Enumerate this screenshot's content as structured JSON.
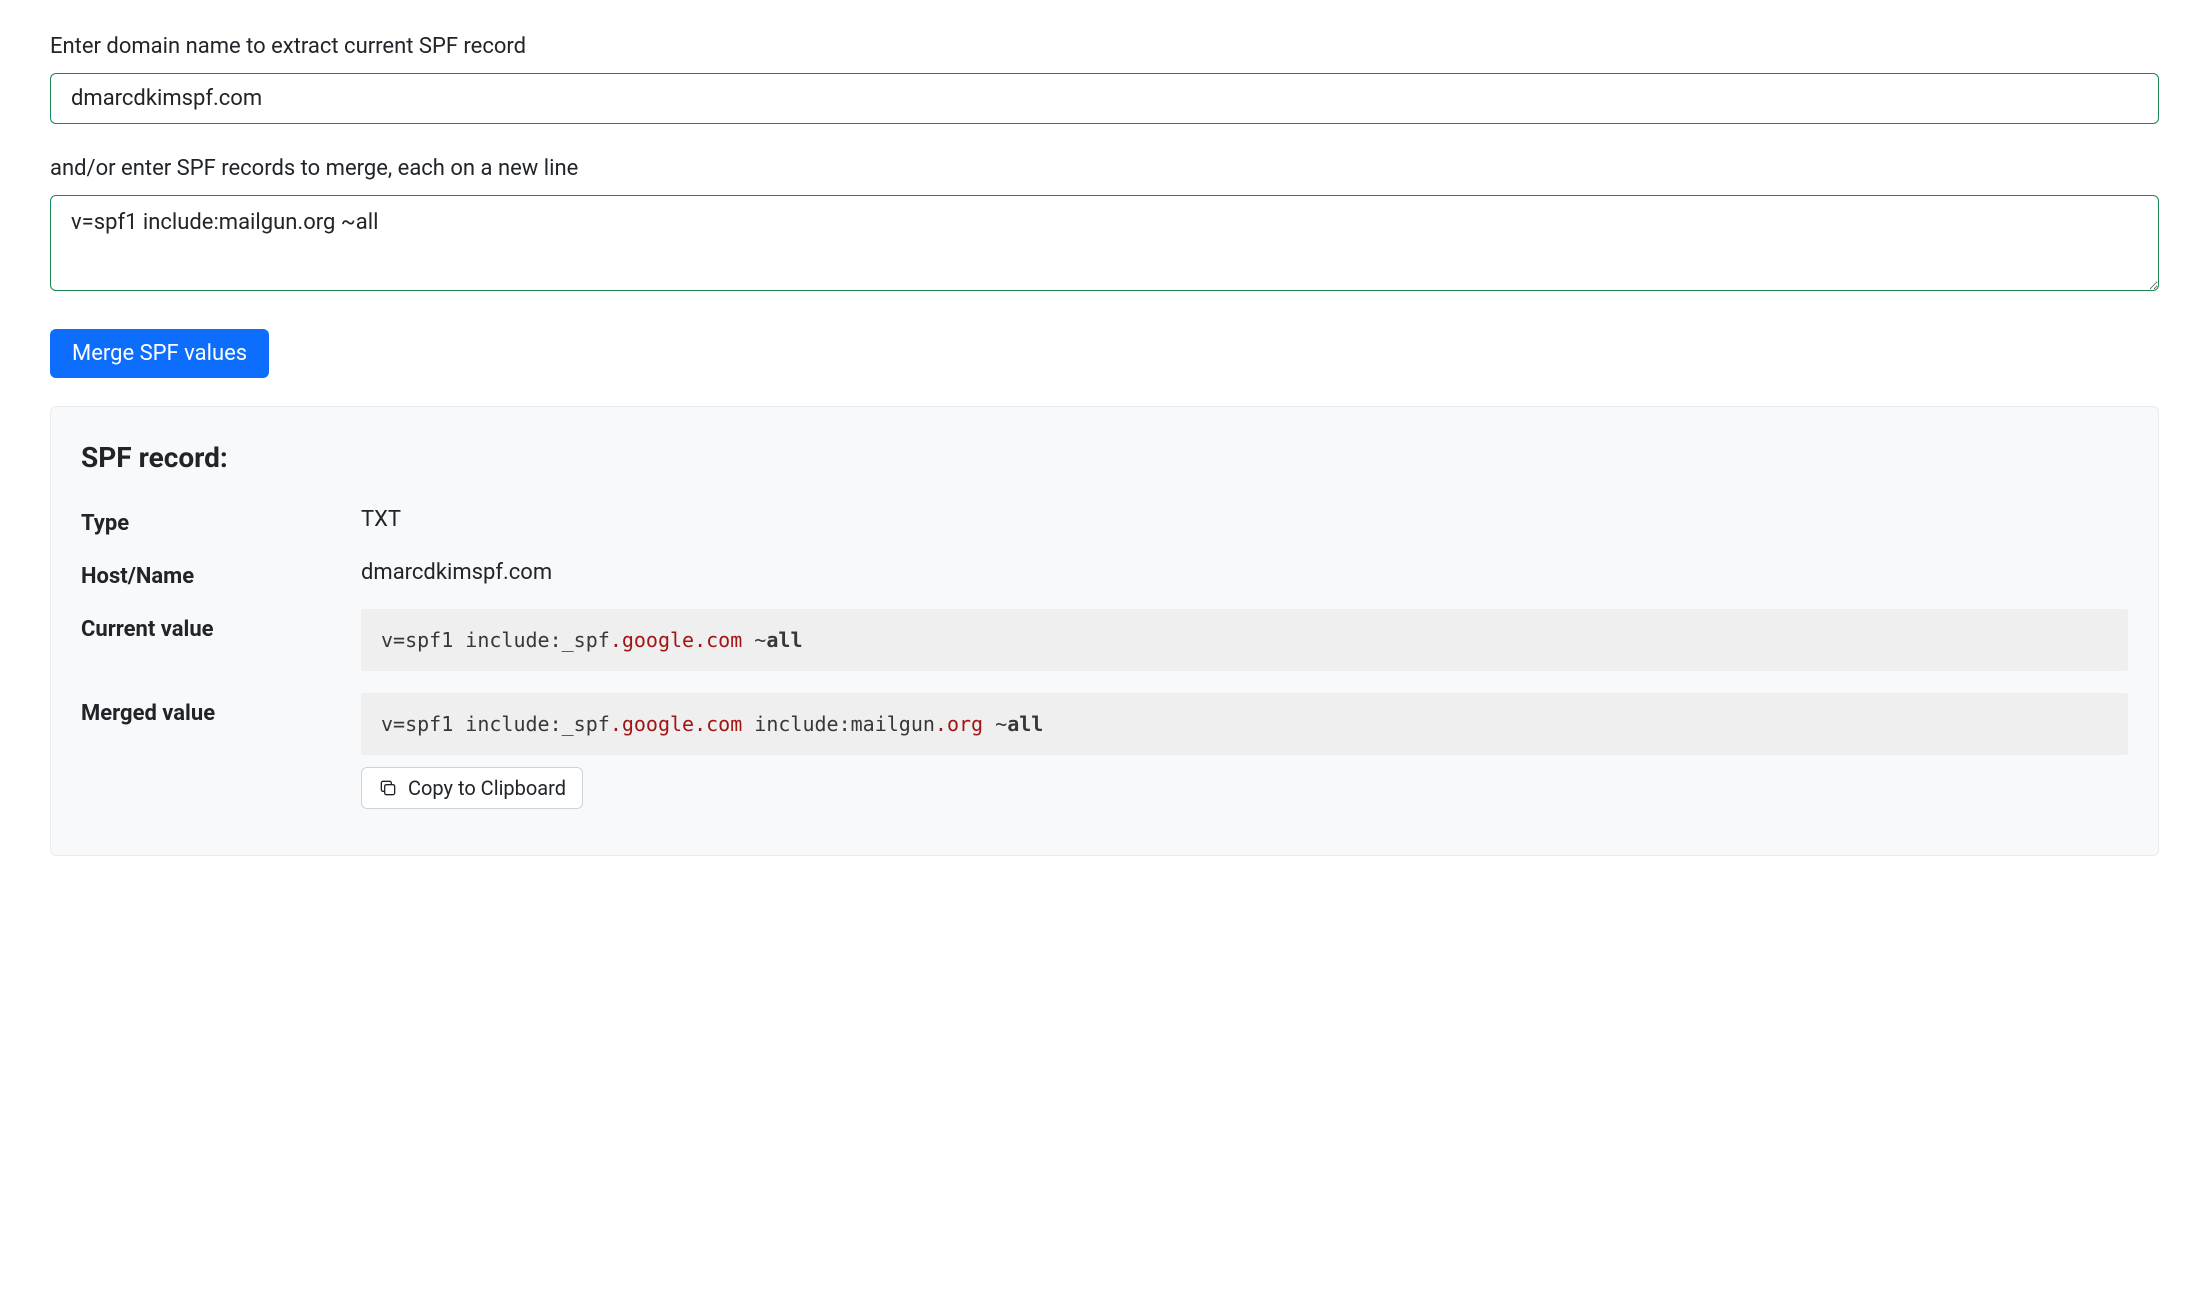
{
  "form": {
    "domain_label": "Enter domain name to extract current SPF record",
    "domain_value": "dmarcdkimspf.com",
    "records_label": "and/or enter SPF records to merge, each on a new line",
    "records_value": "v=spf1 include:mailgun.org ~all",
    "merge_button": "Merge SPF values"
  },
  "result": {
    "heading": "SPF record:",
    "rows": {
      "type_label": "Type",
      "type_value": "TXT",
      "host_label": "Host/Name",
      "host_value": "dmarcdkimspf.com",
      "current_label": "Current value",
      "merged_label": "Merged value"
    },
    "current_tokens": [
      {
        "t": "v=spf1 ",
        "c": "c0"
      },
      {
        "t": "include",
        "c": "c0"
      },
      {
        "t": ":_spf",
        "c": "c0"
      },
      {
        "t": ".google.com",
        "c": "c1"
      },
      {
        "t": " ~",
        "c": "c0"
      },
      {
        "t": "all",
        "c": "c2"
      }
    ],
    "merged_tokens": [
      {
        "t": "v=spf1 ",
        "c": "c0"
      },
      {
        "t": "include",
        "c": "c0"
      },
      {
        "t": ":_spf",
        "c": "c0"
      },
      {
        "t": ".google.com",
        "c": "c1"
      },
      {
        "t": " include:mailgun",
        "c": "c0"
      },
      {
        "t": ".org",
        "c": "c1"
      },
      {
        "t": " ~",
        "c": "c0"
      },
      {
        "t": "all",
        "c": "c2"
      }
    ],
    "copy_button": "Copy to Clipboard"
  }
}
